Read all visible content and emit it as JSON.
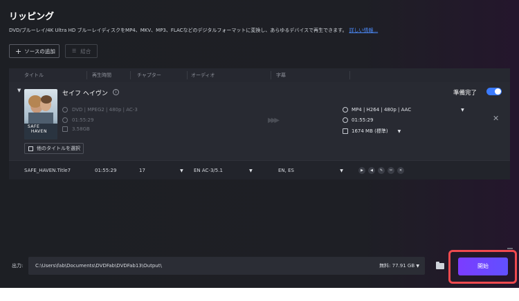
{
  "page": {
    "title": "リッピング",
    "description": "DVD/ブルーレイ/4K Ultra HD ブルーレイディスクをMP4、MKV、MP3、FLACなどのデジタルフォーマットに変換し、あらゆるデバイスで再生できます。",
    "more_link": "詳しい情報..."
  },
  "toolbar": {
    "add_source_label": "ソースの追加",
    "merge_label": "結合"
  },
  "table": {
    "headers": [
      "タイトル",
      "再生時間",
      "チャプター",
      "オーディオ",
      "字幕"
    ]
  },
  "title_item": {
    "movie_title": "セイフ ヘイヴン",
    "poster_text": "SAFE HAVEN",
    "source_format": "DVD | MPEG2 | 480p | AC-3",
    "source_duration": "01:55:29",
    "source_size": "3.58GB",
    "select_other_label": "他のタイトルを選択",
    "output_profile": "MP4 | H264 | 480p | AAC",
    "output_duration": "01:55:29",
    "output_size": "1674 MB (標準)",
    "ready_label": "準備完了",
    "ready_toggle_on": true
  },
  "title_row": {
    "name": "SAFE_HAVEN.Title7",
    "duration": "01:55:29",
    "chapters": "17",
    "audio": "EN  AC-3/5.1",
    "subtitles": "EN, ES"
  },
  "output": {
    "label": "出力:",
    "path": "C:\\Users\\fab\\Documents\\DVDFab\\DVDFab13\\Output\\",
    "free_space": "無料: 77.91 GB"
  },
  "start_button_label": "開始",
  "colors": {
    "accent": "#3b7bff",
    "start_button": "#6a45ff",
    "highlight_outline": "#f04a4f",
    "link": "#4d8dff"
  }
}
